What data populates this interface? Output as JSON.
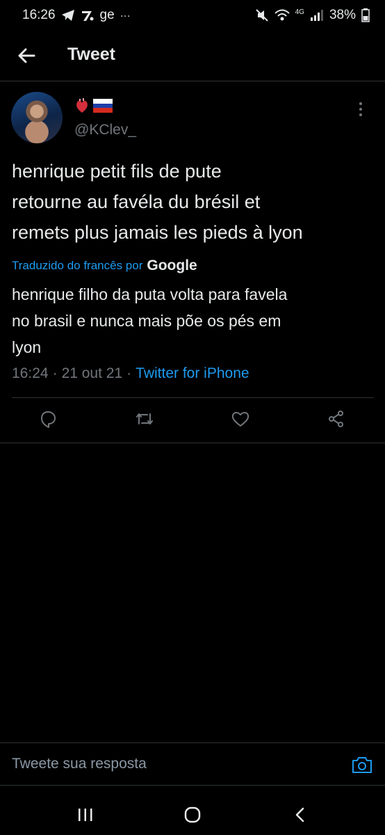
{
  "status_bar": {
    "time": "16:26",
    "carrier": "ge",
    "more": "···",
    "network": "4G",
    "battery": "38%"
  },
  "header": {
    "title": "Tweet"
  },
  "tweet": {
    "handle": "@KClev_",
    "flags": [
      "anatomical-heart-icon",
      "russia-flag-icon"
    ],
    "text_lines": [
      "henrique petit fils de pute",
      "retourne au favéla du brésil et",
      "remets plus jamais les pieds à lyon"
    ],
    "translated_by": "Traduzido do francês por",
    "translator": "Google",
    "translation_lines": [
      "henrique filho da puta volta para favela",
      "no brasil e nunca mais põe os pés em",
      "lyon"
    ],
    "time": "16:24",
    "separator": "·",
    "date": "21 out 21",
    "source": "Twitter for iPhone"
  },
  "reply": {
    "placeholder": "Tweete sua resposta"
  },
  "colors": {
    "accent": "#1d9bf0",
    "muted": "#71767b",
    "text": "#e7e9ea",
    "background": "#000000"
  }
}
